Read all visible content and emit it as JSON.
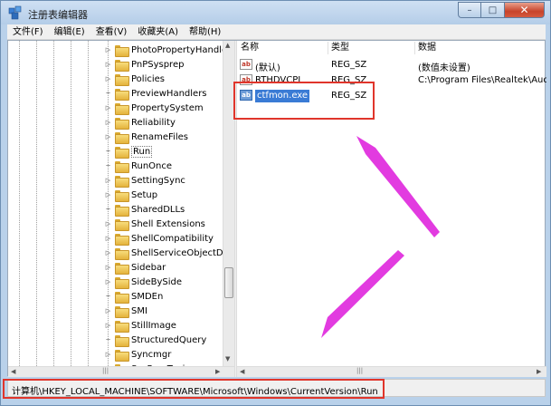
{
  "window": {
    "title": "注册表编辑器",
    "controls": [
      "minimize",
      "maximize",
      "close"
    ]
  },
  "menu": {
    "items": [
      "文件(F)",
      "编辑(E)",
      "查看(V)",
      "收藏夹(A)",
      "帮助(H)"
    ]
  },
  "tree": {
    "items": [
      {
        "label": "PhotoPropertyHandle",
        "expandable": true
      },
      {
        "label": "PnPSysprep",
        "expandable": true
      },
      {
        "label": "Policies",
        "expandable": true
      },
      {
        "label": "PreviewHandlers",
        "expandable": false
      },
      {
        "label": "PropertySystem",
        "expandable": true
      },
      {
        "label": "Reliability",
        "expandable": true
      },
      {
        "label": "RenameFiles",
        "expandable": true
      },
      {
        "label": "Run",
        "expandable": false,
        "selected": true
      },
      {
        "label": "RunOnce",
        "expandable": false
      },
      {
        "label": "SettingSync",
        "expandable": true
      },
      {
        "label": "Setup",
        "expandable": true
      },
      {
        "label": "SharedDLLs",
        "expandable": false
      },
      {
        "label": "Shell Extensions",
        "expandable": true
      },
      {
        "label": "ShellCompatibility",
        "expandable": true
      },
      {
        "label": "ShellServiceObjectDel",
        "expandable": true
      },
      {
        "label": "Sidebar",
        "expandable": true
      },
      {
        "label": "SideBySide",
        "expandable": true
      },
      {
        "label": "SMDEn",
        "expandable": false
      },
      {
        "label": "SMI",
        "expandable": true
      },
      {
        "label": "StillImage",
        "expandable": true
      },
      {
        "label": "StructuredQuery",
        "expandable": false
      },
      {
        "label": "Syncmgr",
        "expandable": true
      },
      {
        "label": "SysPrepTapi",
        "expandable": true
      }
    ]
  },
  "list": {
    "columns": [
      "名称",
      "类型",
      "数据"
    ],
    "rows": [
      {
        "name": "(默认)",
        "type": "REG_SZ",
        "data": "(数值未设置)",
        "selected": false
      },
      {
        "name": "RTHDVCPL",
        "type": "REG_SZ",
        "data": "C:\\Program Files\\Realtek\\Aud",
        "selected": false
      },
      {
        "name": "ctfmon.exe",
        "type": "REG_SZ",
        "data": "",
        "selected": true
      }
    ]
  },
  "status": {
    "path": "计算机\\HKEY_LOCAL_MACHINE\\SOFTWARE\\Microsoft\\Windows\\CurrentVersion\\Run"
  },
  "colors": {
    "annotation_box": "#e0352b",
    "annotation_arrow": "#e23be0",
    "selection": "#3a7bd5"
  },
  "icons": {
    "app": "registry-editor-icon",
    "value": "string-value-icon",
    "folder": "folder-icon"
  }
}
